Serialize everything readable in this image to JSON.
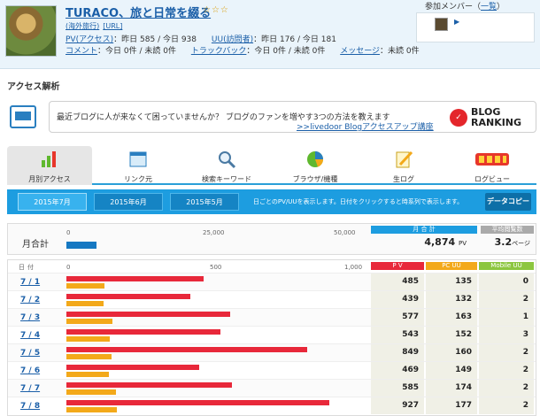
{
  "header": {
    "blog_title": "TURACO、旅と日常を綴る",
    "stars": "☆☆☆",
    "category": "(海外旅行)",
    "url_label": "[URL]",
    "pv_label": "PV(アクセス)",
    "pv_today": "：昨日 585 / 今日 938",
    "uu_label": "UU(訪問者)",
    "uu_today": "：昨日 176 / 今日 181",
    "comment_label": "コメント",
    "comment_text": "：今日 0件 / 未読 0件",
    "trackback_label": "トラックバック",
    "trackback_text": "：今日 0件 / 未読 0件",
    "message_label": "メッセージ",
    "message_text": "：未読 0件",
    "member_label": "参加メンバー（",
    "member_link": "一覧",
    "member_label_end": "）",
    "member_arrow": "▶"
  },
  "section_title": "アクセス解析",
  "promo": {
    "text": "最近ブログに人が来なくて困っていませんか？ ブログのファンを増やす3つの方法を教えます",
    "link": ">>livedoor Blogアクセスアップ講座",
    "logo_line1": "BLOG",
    "logo_line2": "RANKING"
  },
  "tabs": [
    {
      "label": "月別アクセス",
      "icon": "bar-chart-icon"
    },
    {
      "label": "リンク元",
      "icon": "window-icon"
    },
    {
      "label": "検索キーワード",
      "icon": "magnifier-icon"
    },
    {
      "label": "ブラウザ/機種",
      "icon": "pie-chart-icon"
    },
    {
      "label": "生ログ",
      "icon": "pencil-icon"
    },
    {
      "label": "ログビュー",
      "icon": "logview-icon"
    }
  ],
  "months": [
    "2015年7月",
    "2015年6月",
    "2015年5月"
  ],
  "month_note": "日ごとのPV/UUを表示します。日付をクリックすると時系列で表示します。",
  "copy_button": "データコピー",
  "summary": {
    "label": "月合計",
    "axis": [
      "0",
      "25,000",
      "50,000"
    ],
    "total_head": "月 合 計",
    "avg_head": "平均閲覧数",
    "total_pv": "4,874",
    "pv_unit": "PV",
    "avg_pages": "3.2",
    "avg_unit": "ページ"
  },
  "daily": {
    "date_head": "日付",
    "axis": [
      "0",
      "500",
      "1,000"
    ],
    "col_pv": "P V",
    "col_uu": "PC UU",
    "col_mobile": "Mobile UU",
    "rows": [
      {
        "day": "7 / 1",
        "pv": "485",
        "uu": "135",
        "mobile": "0"
      },
      {
        "day": "7 / 2",
        "pv": "439",
        "uu": "132",
        "mobile": "2"
      },
      {
        "day": "7 / 3",
        "pv": "577",
        "uu": "163",
        "mobile": "1"
      },
      {
        "day": "7 / 4",
        "pv": "543",
        "uu": "152",
        "mobile": "3"
      },
      {
        "day": "7 / 5",
        "pv": "849",
        "uu": "160",
        "mobile": "2"
      },
      {
        "day": "7 / 6",
        "pv": "469",
        "uu": "149",
        "mobile": "2"
      },
      {
        "day": "7 / 7",
        "pv": "585",
        "uu": "174",
        "mobile": "2"
      },
      {
        "day": "7 / 8",
        "pv": "927",
        "uu": "177",
        "mobile": "2"
      }
    ]
  },
  "colors": {
    "accent": "#1d9de0",
    "pv_bar": "#e8283a",
    "uu_bar": "#f3a91a",
    "summary_bar": "#1578c2",
    "mobile_head": "#8cc63f"
  }
}
